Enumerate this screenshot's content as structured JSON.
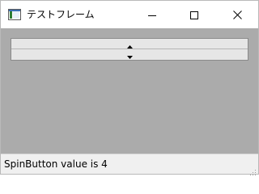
{
  "window": {
    "title": "テストフレーム",
    "icon": "frame-app-icon"
  },
  "caption_buttons": {
    "minimize_icon": "minimize-icon",
    "maximize_icon": "maximize-icon",
    "close_icon": "close-icon"
  },
  "spin_button": {
    "up_icon": "up-arrow-icon",
    "down_icon": "down-arrow-icon",
    "value": 4
  },
  "statusbar": {
    "text": "SpinButton value is 4"
  },
  "colors": {
    "client_bg": "#ababab",
    "status_bg": "#f0f0f0",
    "titlebar_bg": "#ffffff"
  }
}
